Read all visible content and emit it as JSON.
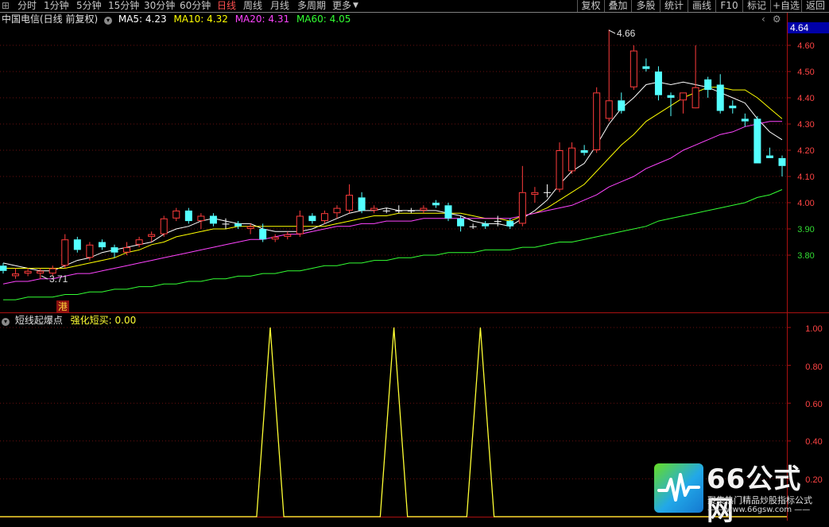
{
  "toolbar": {
    "left_icon": "grid-icon",
    "periods": [
      {
        "label": "分时",
        "active": false
      },
      {
        "label": "1分钟",
        "active": false
      },
      {
        "label": "5分钟",
        "active": false
      },
      {
        "label": "15分钟",
        "active": false
      },
      {
        "label": "30分钟",
        "active": false
      },
      {
        "label": "60分钟",
        "active": false
      },
      {
        "label": "日线",
        "active": true
      },
      {
        "label": "周线",
        "active": false
      },
      {
        "label": "月线",
        "active": false
      },
      {
        "label": "多周期",
        "active": false
      },
      {
        "label": "更多",
        "active": false
      }
    ],
    "more_arrow": "triangle-down-icon",
    "right_buttons": [
      "复权",
      "叠加",
      "多股",
      "统计",
      "画线",
      "F10",
      "标记",
      "+自选",
      "返回"
    ]
  },
  "main_panel": {
    "title": "中国电信(日线 前复权)",
    "ma_legend": [
      {
        "label": "MA5: 4.23",
        "color": "#ffffff"
      },
      {
        "label": "MA10: 4.32",
        "color": "#ffff00"
      },
      {
        "label": "MA20: 4.31",
        "color": "#ff44ff"
      },
      {
        "label": "MA60: 4.05",
        "color": "#33ff33"
      }
    ],
    "current_price_tag": "4.64",
    "high_label": "4.66",
    "low_label": "3.71",
    "event_marker": "港",
    "y_axis_labels": [
      "4.60",
      "4.50",
      "4.40",
      "4.30",
      "4.20",
      "4.10",
      "4.00",
      "3.90",
      "3.80"
    ]
  },
  "indicator_panel": {
    "name": "短线起爆点",
    "value_label": "强化短买: 0.00",
    "y_axis_labels": [
      "1.00",
      "0.80",
      "0.60",
      "0.40",
      "0.20"
    ]
  },
  "chart_data": {
    "type": "candlestick",
    "ylim": [
      3.71,
      4.66
    ],
    "candles": [
      [
        3.76,
        3.77,
        3.73,
        3.74
      ],
      [
        3.72,
        3.75,
        3.71,
        3.73
      ],
      [
        3.73,
        3.75,
        3.72,
        3.74
      ],
      [
        3.73,
        3.75,
        3.71,
        3.74
      ],
      [
        3.73,
        3.76,
        3.72,
        3.75
      ],
      [
        3.76,
        3.88,
        3.75,
        3.86
      ],
      [
        3.86,
        3.87,
        3.81,
        3.82
      ],
      [
        3.79,
        3.85,
        3.78,
        3.84
      ],
      [
        3.85,
        3.86,
        3.82,
        3.83
      ],
      [
        3.83,
        3.84,
        3.79,
        3.81
      ],
      [
        3.81,
        3.85,
        3.8,
        3.83
      ],
      [
        3.84,
        3.87,
        3.83,
        3.86
      ],
      [
        3.87,
        3.89,
        3.85,
        3.88
      ],
      [
        3.88,
        3.95,
        3.87,
        3.94
      ],
      [
        3.94,
        3.98,
        3.93,
        3.97
      ],
      [
        3.97,
        3.98,
        3.92,
        3.93
      ],
      [
        3.93,
        3.96,
        3.9,
        3.95
      ],
      [
        3.95,
        3.96,
        3.91,
        3.92
      ],
      [
        3.92,
        3.94,
        3.9,
        3.92
      ],
      [
        3.92,
        3.93,
        3.9,
        3.91
      ],
      [
        3.9,
        3.92,
        3.88,
        3.91
      ],
      [
        3.9,
        3.92,
        3.85,
        3.86
      ],
      [
        3.86,
        3.88,
        3.85,
        3.87
      ],
      [
        3.87,
        3.89,
        3.86,
        3.88
      ],
      [
        3.88,
        3.97,
        3.87,
        3.95
      ],
      [
        3.95,
        3.96,
        3.92,
        3.93
      ],
      [
        3.93,
        3.97,
        3.92,
        3.96
      ],
      [
        3.96,
        3.99,
        3.94,
        3.98
      ],
      [
        3.97,
        4.07,
        3.96,
        4.03
      ],
      [
        4.02,
        4.04,
        3.96,
        3.97
      ],
      [
        3.97,
        3.99,
        3.96,
        3.98
      ],
      [
        3.97,
        3.98,
        3.96,
        3.97
      ],
      [
        3.97,
        3.99,
        3.96,
        3.97
      ],
      [
        3.97,
        3.98,
        3.96,
        3.97
      ],
      [
        3.97,
        3.99,
        3.96,
        3.98
      ],
      [
        4.0,
        4.01,
        3.98,
        3.99
      ],
      [
        3.99,
        4.0,
        3.93,
        3.94
      ],
      [
        3.94,
        3.95,
        3.89,
        3.91
      ],
      [
        3.91,
        3.92,
        3.9,
        3.91
      ],
      [
        3.92,
        3.93,
        3.9,
        3.91
      ],
      [
        3.93,
        3.95,
        3.91,
        3.93
      ],
      [
        3.93,
        3.94,
        3.9,
        3.91
      ],
      [
        3.92,
        4.14,
        3.91,
        4.04
      ],
      [
        4.03,
        4.06,
        4.0,
        4.04
      ],
      [
        4.04,
        4.07,
        4.02,
        4.04
      ],
      [
        4.05,
        4.23,
        4.04,
        4.2
      ],
      [
        4.12,
        4.23,
        4.11,
        4.21
      ],
      [
        4.2,
        4.22,
        4.18,
        4.19
      ],
      [
        4.2,
        4.44,
        4.19,
        4.42
      ],
      [
        4.32,
        4.66,
        4.31,
        4.39
      ],
      [
        4.39,
        4.42,
        4.34,
        4.35
      ],
      [
        4.44,
        4.6,
        4.43,
        4.58
      ],
      [
        4.52,
        4.55,
        4.5,
        4.51
      ],
      [
        4.5,
        4.52,
        4.39,
        4.41
      ],
      [
        4.41,
        4.42,
        4.33,
        4.4
      ],
      [
        4.39,
        4.42,
        4.34,
        4.42
      ],
      [
        4.36,
        4.6,
        4.38,
        4.44
      ],
      [
        4.47,
        4.48,
        4.4,
        4.43
      ],
      [
        4.45,
        4.49,
        4.34,
        4.35
      ],
      [
        4.37,
        4.39,
        4.34,
        4.36
      ],
      [
        4.32,
        4.34,
        4.29,
        4.31
      ],
      [
        4.32,
        4.33,
        4.15,
        4.15
      ],
      [
        4.18,
        4.21,
        4.17,
        4.17
      ],
      [
        4.17,
        4.18,
        4.1,
        4.14
      ]
    ],
    "series": [
      {
        "name": "MA5",
        "color": "#ffffff",
        "values": [
          3.77,
          3.76,
          3.75,
          3.74,
          3.74,
          3.76,
          3.78,
          3.79,
          3.81,
          3.82,
          3.83,
          3.84,
          3.85,
          3.88,
          3.9,
          3.91,
          3.93,
          3.94,
          3.93,
          3.92,
          3.92,
          3.9,
          3.89,
          3.89,
          3.89,
          3.9,
          3.92,
          3.94,
          3.96,
          3.97,
          3.97,
          3.98,
          3.97,
          3.97,
          3.97,
          3.97,
          3.96,
          3.95,
          3.93,
          3.92,
          3.92,
          3.91,
          3.94,
          3.97,
          4.01,
          4.07,
          4.12,
          4.15,
          4.22,
          4.3,
          4.36,
          4.4,
          4.45,
          4.46,
          4.45,
          4.46,
          4.45,
          4.44,
          4.42,
          4.4,
          4.38,
          4.32,
          4.27,
          4.24
        ]
      },
      {
        "name": "MA10",
        "color": "#ffff00",
        "values": [
          3.75,
          3.75,
          3.75,
          3.75,
          3.75,
          3.75,
          3.76,
          3.77,
          3.78,
          3.79,
          3.81,
          3.82,
          3.84,
          3.85,
          3.87,
          3.88,
          3.89,
          3.9,
          3.9,
          3.91,
          3.91,
          3.91,
          3.91,
          3.91,
          3.91,
          3.91,
          3.91,
          3.92,
          3.93,
          3.94,
          3.95,
          3.95,
          3.96,
          3.96,
          3.96,
          3.96,
          3.96,
          3.96,
          3.95,
          3.94,
          3.94,
          3.93,
          3.95,
          3.96,
          3.98,
          4.01,
          4.04,
          4.07,
          4.12,
          4.17,
          4.22,
          4.26,
          4.31,
          4.34,
          4.37,
          4.4,
          4.42,
          4.44,
          4.44,
          4.43,
          4.43,
          4.4,
          4.36,
          4.32
        ]
      },
      {
        "name": "MA20",
        "color": "#ff44ff",
        "values": [
          3.69,
          3.7,
          3.7,
          3.71,
          3.71,
          3.72,
          3.73,
          3.73,
          3.74,
          3.75,
          3.76,
          3.77,
          3.78,
          3.79,
          3.8,
          3.81,
          3.82,
          3.83,
          3.84,
          3.85,
          3.86,
          3.86,
          3.87,
          3.88,
          3.88,
          3.89,
          3.9,
          3.91,
          3.91,
          3.92,
          3.92,
          3.93,
          3.93,
          3.93,
          3.94,
          3.94,
          3.94,
          3.94,
          3.94,
          3.94,
          3.94,
          3.94,
          3.95,
          3.96,
          3.97,
          3.98,
          3.99,
          4.01,
          4.03,
          4.06,
          4.08,
          4.1,
          4.13,
          4.15,
          4.17,
          4.2,
          4.22,
          4.24,
          4.26,
          4.27,
          4.29,
          4.3,
          4.31,
          4.31
        ]
      },
      {
        "name": "MA60",
        "color": "#33ff33",
        "values": [
          3.63,
          3.63,
          3.64,
          3.64,
          3.64,
          3.65,
          3.65,
          3.66,
          3.66,
          3.67,
          3.67,
          3.68,
          3.68,
          3.69,
          3.69,
          3.7,
          3.7,
          3.71,
          3.71,
          3.72,
          3.72,
          3.73,
          3.73,
          3.74,
          3.74,
          3.75,
          3.76,
          3.76,
          3.77,
          3.77,
          3.78,
          3.78,
          3.79,
          3.79,
          3.8,
          3.8,
          3.81,
          3.81,
          3.81,
          3.82,
          3.82,
          3.82,
          3.83,
          3.83,
          3.84,
          3.85,
          3.85,
          3.86,
          3.87,
          3.88,
          3.89,
          3.9,
          3.91,
          3.93,
          3.94,
          3.95,
          3.96,
          3.97,
          3.98,
          3.99,
          4.0,
          4.02,
          4.03,
          4.05
        ]
      }
    ],
    "indicator": {
      "name": "短线起爆点",
      "ylim": [
        0,
        1
      ],
      "spikes_at_index": [
        21,
        31,
        38
      ],
      "values_zero_elsewhere": 0
    }
  },
  "watermark": {
    "title": "66公式网",
    "subtitle": "聚集热门精品炒股指标公式",
    "url": "www.66gsw.com",
    "icon": "pulse-logo-icon"
  }
}
